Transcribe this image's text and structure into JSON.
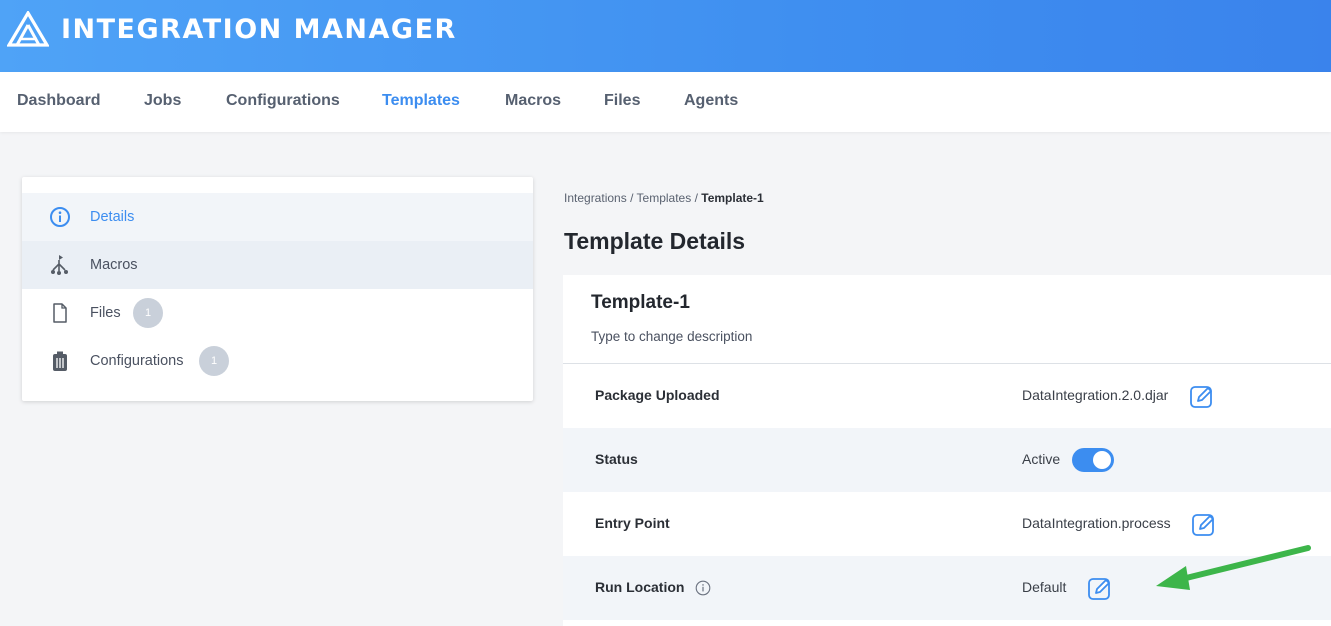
{
  "header": {
    "app_title": "INTEGRATION MANAGER",
    "logo_icon": "mountain-logo-icon",
    "accent": "#3c8df0"
  },
  "nav": {
    "items": [
      {
        "label": "Dashboard"
      },
      {
        "label": "Jobs"
      },
      {
        "label": "Configurations"
      },
      {
        "label": "Templates",
        "active": true
      },
      {
        "label": "Macros"
      },
      {
        "label": "Files"
      },
      {
        "label": "Agents"
      }
    ]
  },
  "sidebar": {
    "items": [
      {
        "label": "Details",
        "icon": "info-icon",
        "active": true
      },
      {
        "label": "Macros",
        "icon": "hierarchy-icon"
      },
      {
        "label": "Files",
        "icon": "file-icon",
        "count": "1"
      },
      {
        "label": "Configurations",
        "icon": "trash-bin-icon",
        "count": "1"
      }
    ]
  },
  "breadcrumb": {
    "part1": "Integrations",
    "sep": "/",
    "part2": "Templates",
    "current": "Template-1"
  },
  "page_title": "Template Details",
  "template": {
    "name": "Template-1",
    "description_placeholder": "Type to change description"
  },
  "details": {
    "package": {
      "label": "Package Uploaded",
      "value": "DataIntegration.2.0.djar"
    },
    "status": {
      "label": "Status",
      "value": "Active",
      "enabled": true
    },
    "entry_point": {
      "label": "Entry Point",
      "value": "DataIntegration.process"
    },
    "run_location": {
      "label": "Run Location",
      "value": "Default"
    }
  },
  "annotation": {
    "arrow_color": "#3db54a"
  }
}
